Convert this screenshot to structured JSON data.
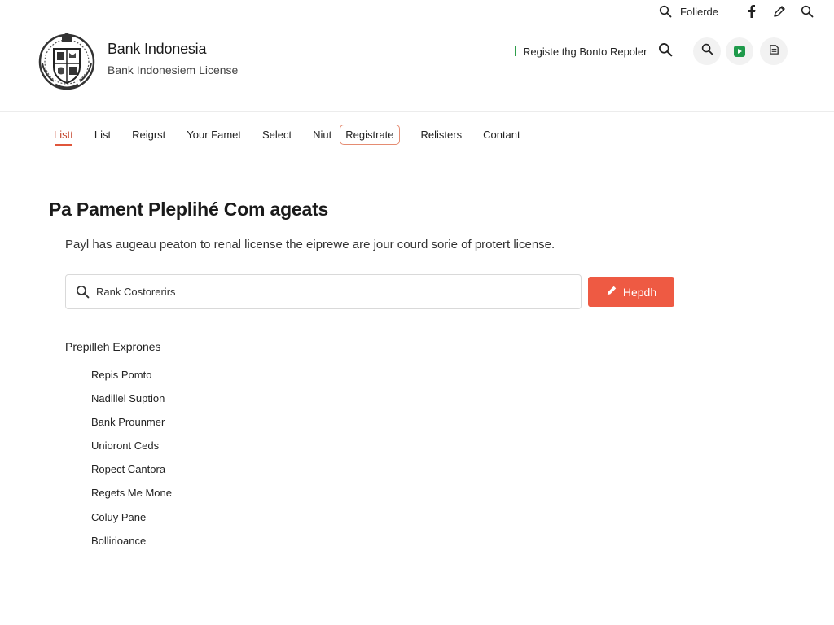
{
  "utility_bar": {
    "label": "Folierde"
  },
  "header": {
    "title": "Bank Indonesia",
    "subtitle": "Bank Indonesiem License",
    "register_link": "Registe thg Bonto Repoler"
  },
  "nav": {
    "items": [
      {
        "label": "Listt",
        "active": true
      },
      {
        "label": "List"
      },
      {
        "label": "Reigrst"
      },
      {
        "label": "Your Famet"
      },
      {
        "label": "Select"
      },
      {
        "label": "Niut"
      },
      {
        "label": "Registrate",
        "boxed": true
      },
      {
        "label": "Relisters"
      },
      {
        "label": "Contant"
      }
    ]
  },
  "main": {
    "title": "Pa Pament Pleplihé Com ageats",
    "description": "Payl has augeau peaton to renal license the eiprewe are jour courd sorie of protert license.",
    "search": {
      "value": "Rank Costorerirs",
      "placeholder": ""
    },
    "action_button": "Hepdh",
    "list_heading": "Prepilleh Exprones",
    "list_items": [
      "Repis Pomto",
      "Nadillel Suption",
      "Bank Prounmer",
      "Unioront Ceds",
      "Ropect Cantora",
      "Regets Me Mone",
      "Coluy Pane",
      "Bollirioance"
    ]
  },
  "colors": {
    "accent": "#ee5a43",
    "accent_text": "#c4452c",
    "green": "#1f9a4b"
  }
}
